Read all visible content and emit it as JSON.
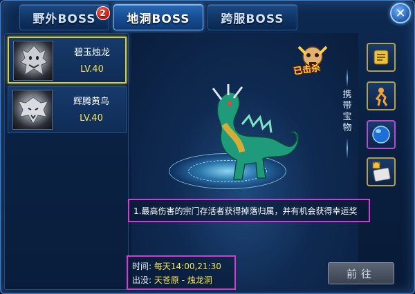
{
  "tabs": [
    {
      "label": "野外BOSS",
      "badge": "2"
    },
    {
      "label": "地洞BOSS"
    },
    {
      "label": "跨服BOSS"
    }
  ],
  "bosses": [
    {
      "name": "碧玉烛龙",
      "level": "LV.40"
    },
    {
      "name": "辉腾黄鸟",
      "level": "LV.40"
    }
  ],
  "status": {
    "killed": "已击杀"
  },
  "carry": {
    "label": "携带宝物"
  },
  "description": "1.最高伤害的宗门存活者获得掉落归属，并有机会获得幸运奖",
  "info": {
    "time_label": "时间:",
    "time_value": "每天14:00,21:30",
    "location_label": "出没:",
    "location_value": "天苍原 - 烛龙洞"
  },
  "go_button": "前往",
  "colors": {
    "selected_border": "#d8cf37",
    "highlight_box": "#d43bd4",
    "level_text": "#f4e35a"
  }
}
